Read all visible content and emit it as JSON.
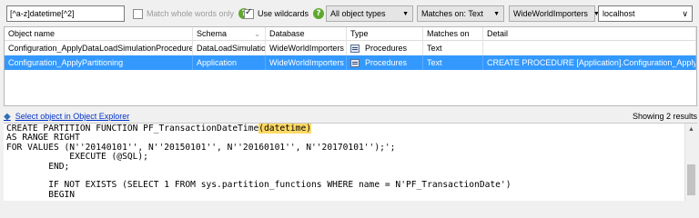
{
  "toolbar": {
    "search_value": "[^a-z]datetime[^2]",
    "match_whole_words_label": "Match whole words only",
    "use_wildcards_label": "Use wildcards",
    "object_types": "All object types",
    "matches_on": "Matches on: Text",
    "database": "WideWorldImporters",
    "server": "localhost"
  },
  "grid": {
    "columns": [
      "Object name",
      "Schema",
      "Database",
      "Type",
      "Matches on",
      "Detail"
    ],
    "rows": [
      {
        "name": "Configuration_ApplyDataLoadSimulationProcedures",
        "schema": "DataLoadSimulation",
        "database": "WideWorldImporters",
        "type": "Procedures",
        "matches_on": "Text",
        "detail": ""
      },
      {
        "name": "Configuration_ApplyPartitioning",
        "schema": "Application",
        "database": "WideWorldImporters",
        "type": "Procedures",
        "matches_on": "Text",
        "detail": "CREATE PROCEDURE [Application].Configuration_ApplyPartit..."
      }
    ]
  },
  "status": {
    "link": "Select object in Object Explorer",
    "results": "Showing 2 results"
  },
  "code": {
    "l1_pre": "CREATE PARTITION FUNCTION PF_TransactionDateTime",
    "l1_hl": "(datetime)",
    "l2": "AS RANGE RIGHT",
    "l3": "FOR VALUES (N''20140101'', N''20150101'', N''20160101'', N''20170101'');';",
    "l4": "            EXECUTE (@SQL);",
    "l5": "        END;",
    "l6": "",
    "l7": "        IF NOT EXISTS (SELECT 1 FROM sys.partition_functions WHERE name = N'PF_TransactionDate')",
    "l8": "        BEGIN"
  }
}
